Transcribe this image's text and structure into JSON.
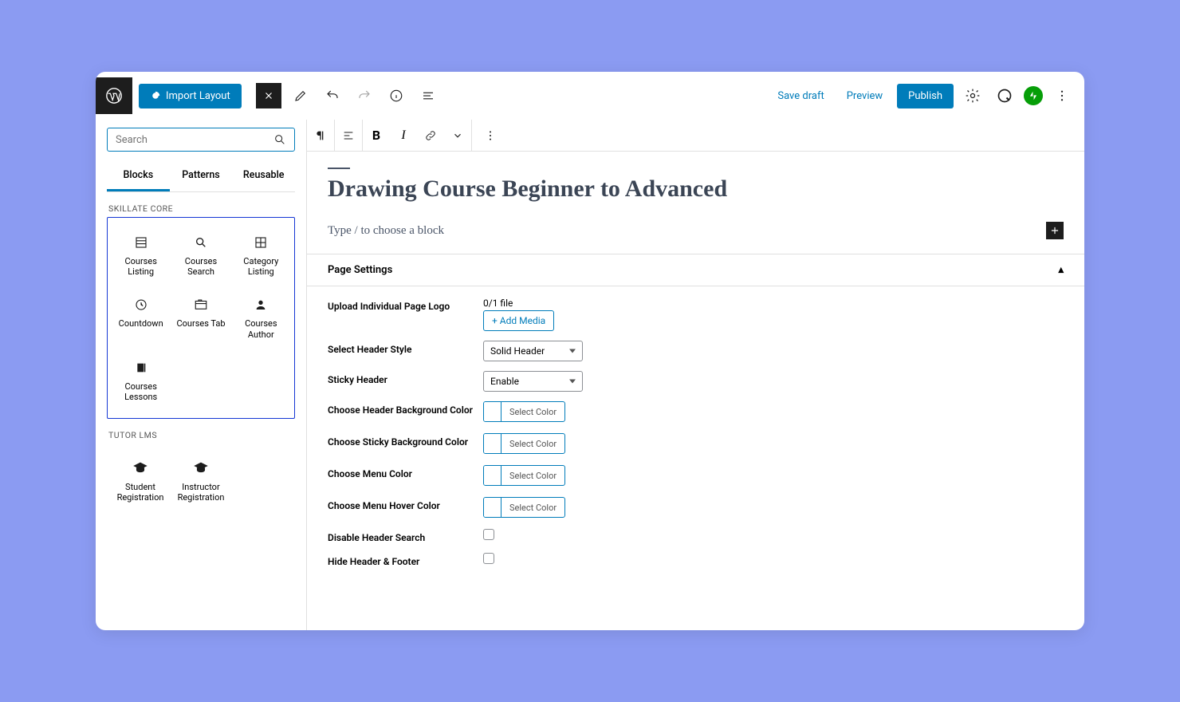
{
  "topbar": {
    "import_label": "Import Layout",
    "save_draft": "Save draft",
    "preview": "Preview",
    "publish": "Publish"
  },
  "sidebar": {
    "search_placeholder": "Search",
    "tabs": [
      "Blocks",
      "Patterns",
      "Reusable"
    ],
    "section1_label": "SKILLATE CORE",
    "section2_label": "TUTOR LMS",
    "skillate": [
      {
        "label": "Courses Listing"
      },
      {
        "label": "Courses Search"
      },
      {
        "label": "Category Listing"
      },
      {
        "label": "Countdown"
      },
      {
        "label": "Courses Tab"
      },
      {
        "label": "Courses Author"
      },
      {
        "label": "Courses Lessons"
      }
    ],
    "tutor": [
      {
        "label": "Student Registration"
      },
      {
        "label": "Instructor Registration"
      }
    ]
  },
  "editor": {
    "title": "Drawing Course Beginner to Advanced",
    "type_placeholder": "Type / to choose a block"
  },
  "settings": {
    "panel_title": "Page Settings",
    "rows": {
      "upload_logo_label": "Upload Individual Page Logo",
      "upload_logo_info": "0/1 file",
      "add_media": "+ Add Media",
      "header_style_label": "Select Header Style",
      "header_style_value": "Solid Header",
      "sticky_header_label": "Sticky Header",
      "sticky_header_value": "Enable",
      "header_bg_label": "Choose Header Background Color",
      "sticky_bg_label": "Choose Sticky Background Color",
      "menu_color_label": "Choose Menu Color",
      "menu_hover_label": "Choose Menu Hover Color",
      "select_color": "Select Color",
      "disable_search_label": "Disable Header Search",
      "hide_header_footer_label": "Hide Header & Footer"
    }
  }
}
